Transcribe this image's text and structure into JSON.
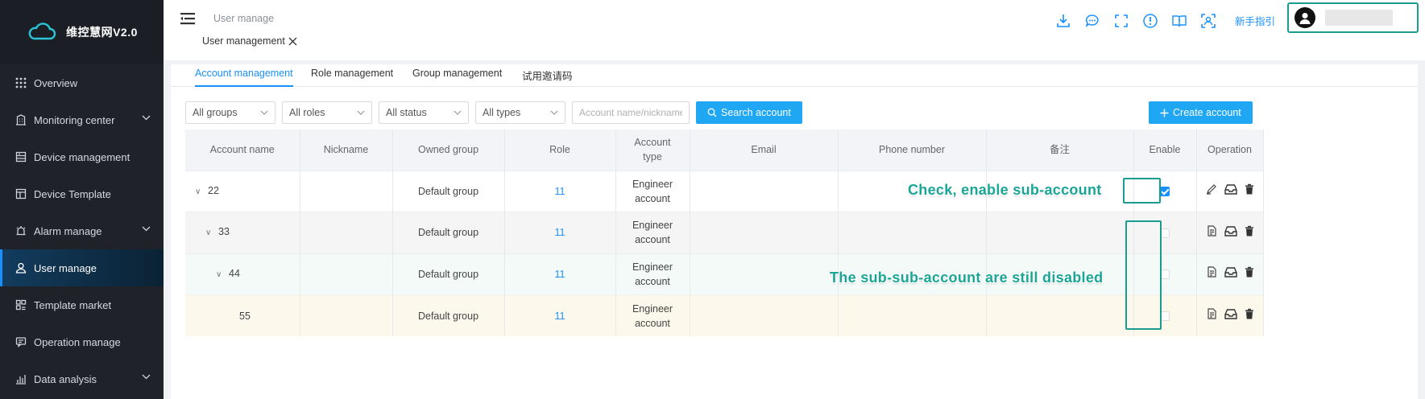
{
  "brand": {
    "name": "维控慧网V2.0"
  },
  "sidebar": {
    "items": [
      {
        "label": "Overview",
        "icon": "grid-icon",
        "expandable": false,
        "active": false
      },
      {
        "label": "Monitoring center",
        "icon": "building-icon",
        "expandable": true,
        "active": false
      },
      {
        "label": "Device management",
        "icon": "device-icon",
        "expandable": false,
        "active": false
      },
      {
        "label": "Device Template",
        "icon": "template-icon",
        "expandable": false,
        "active": false
      },
      {
        "label": "Alarm manage",
        "icon": "alarm-icon",
        "expandable": true,
        "active": false
      },
      {
        "label": "User manage",
        "icon": "user-icon",
        "expandable": false,
        "active": true
      },
      {
        "label": "Template market",
        "icon": "market-icon",
        "expandable": false,
        "active": false
      },
      {
        "label": "Operation manage",
        "icon": "chat-icon",
        "expandable": false,
        "active": false
      },
      {
        "label": "Data analysis",
        "icon": "bar-chart-icon",
        "expandable": true,
        "active": false
      }
    ]
  },
  "header": {
    "breadcrumb": "User manage",
    "open_tab": "User management",
    "guide": "新手指引",
    "icons": [
      "download-icon",
      "message-icon",
      "fullscreen-icon",
      "info-icon",
      "book-icon",
      "scan-icon"
    ]
  },
  "tabs": [
    "Account management",
    "Role management",
    "Group management",
    "试用邀请码"
  ],
  "filters": {
    "group": "All groups",
    "role": "All roles",
    "status": "All status",
    "type": "All types",
    "search_placeholder": "Account name/nickname",
    "search_button": "Search account",
    "create_button": "Create account"
  },
  "table": {
    "columns": [
      "Account name",
      "Nickname",
      "Owned group",
      "Role",
      "Account type",
      "Email",
      "Phone number",
      "备注",
      "Enable",
      "Operation"
    ],
    "rows": [
      {
        "name": "22",
        "level": 0,
        "expandable": true,
        "nickname": "",
        "group": "Default group",
        "role": "11",
        "type": "Engineer account",
        "email": "",
        "phone": "",
        "remark": "",
        "enabled": true
      },
      {
        "name": "33",
        "level": 1,
        "expandable": true,
        "nickname": "",
        "group": "Default group",
        "role": "11",
        "type": "Engineer account",
        "email": "",
        "phone": "",
        "remark": "",
        "enabled": false
      },
      {
        "name": "44",
        "level": 2,
        "expandable": true,
        "nickname": "",
        "group": "Default group",
        "role": "11",
        "type": "Engineer account",
        "email": "",
        "phone": "",
        "remark": "",
        "enabled": false
      },
      {
        "name": "55",
        "level": 3,
        "expandable": false,
        "nickname": "",
        "group": "Default group",
        "role": "11",
        "type": "Engineer account",
        "email": "",
        "phone": "",
        "remark": "",
        "enabled": false
      }
    ]
  },
  "annotations": {
    "enable_note": "Check, enable sub-account",
    "disabled_note": "The sub-sub-account are still disabled"
  },
  "colors": {
    "accent": "#1890ff",
    "button": "#1fa7f3",
    "sidebar_bg": "#1f2229",
    "annotation": "#1aa596"
  }
}
